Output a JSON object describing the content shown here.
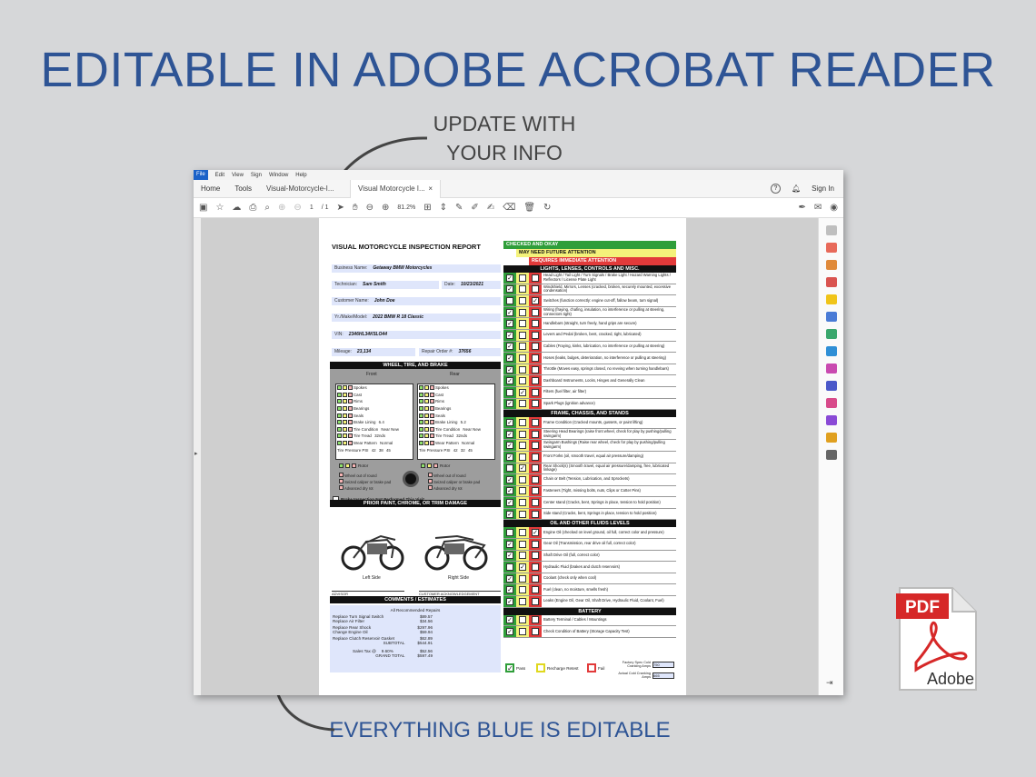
{
  "headline": "EDITABLE IN ADOBE ACROBAT READER",
  "callout_top": [
    "UPDATE WITH",
    "YOUR INFO"
  ],
  "callout_bottom": "EVERYTHING BLUE IS EDITABLE",
  "colors": {
    "headline_blue": "#2e5495",
    "pass_green": "#2f9e3a",
    "attention_yellow": "#f4f27a",
    "fail_red": "#e23a3a",
    "editable_field_blue": "#dfe6fb"
  },
  "app": {
    "menu": [
      "File",
      "Edit",
      "View",
      "Sign",
      "Window",
      "Help"
    ],
    "tabs": {
      "home": "Home",
      "tools": "Tools",
      "doc1": "Visual-Motorcycle-I...",
      "doc2": "Visual Motorcycle I...",
      "close": "×"
    },
    "help": "?",
    "sign_in": "Sign In",
    "page_current": "1",
    "page_total": "/ 1",
    "zoom": "81.2%"
  },
  "form": {
    "title": "VISUAL MOTORCYCLE INSPECTION REPORT",
    "fields": [
      {
        "label": "Business Name:",
        "value": "Getaway BMW Motorcycles"
      },
      {
        "label": "Technician:",
        "value": "Sam Smith"
      },
      {
        "label": "Date:",
        "value": "10/23/2021"
      },
      {
        "label": "Customer Name:",
        "value": "John Doe"
      },
      {
        "label": "Yr./Make/Model:",
        "value": "2022  BMW  R 18  Classic"
      },
      {
        "label": "VIN:",
        "value": "2346HL34K5LO44"
      },
      {
        "label": "Mileage:",
        "value": "23,134"
      },
      {
        "label": "Repair Order #:",
        "value": "37656"
      }
    ],
    "wheel_section": "WHEEL, TIRE, AND BRAKE",
    "front": "Front",
    "rear": "Rear",
    "wheel_items": [
      "Spokes",
      "Cast",
      "Rims",
      "Bearings",
      "Seals",
      "Brake Lining",
      "Tire Condition",
      "Tire Tread",
      "Wear Pattern",
      "Tire Pressure PSI"
    ],
    "front_values": {
      "brake_lining": "6.4",
      "tire_condition": "Near New",
      "tire_tread": "32nds",
      "wear_pattern": "Normal",
      "pressure": "42",
      "before": "38",
      "after": "45"
    },
    "rear_values": {
      "brake_lining": "5.2",
      "tire_condition": "Near New",
      "tire_tread": "32nds",
      "wear_pattern": "Normal",
      "pressure": "42",
      "before": "32",
      "after": "45"
    },
    "rotor": "Rotor",
    "rotor_items": [
      "Wheel out of round",
      "Seized caliper or brake pad",
      "Advanced dry rot"
    ],
    "brake_not_performed": "Brake Inspection Not Performed This Visit",
    "paint_section": "PRIOR PAINT, CHROME, OR TRIM DAMAGE",
    "left_side": "Left Side",
    "right_side": "Right Side",
    "advisor": "ADVISOR",
    "customer_ack": "CUSTOMER ACKNOWLEDGEMENT",
    "comments_section": "COMMENTS / ESTIMATES",
    "comments_header": "All Recommended Repairs",
    "estimates": [
      {
        "item": "Replace Turn Signal Switch",
        "price": "$89.57"
      },
      {
        "item": "Replace Air Filter",
        "price": "$34.56"
      },
      {
        "item": "Replace Rear Shock",
        "price": "$297.96"
      },
      {
        "item": "Change Engine Oil",
        "price": "$59.94"
      },
      {
        "item": "Replace Clutch Reservoir Gasket",
        "price": "$62.89"
      }
    ],
    "subtotal_label": "SUBTOTAL",
    "subtotal": "$544.91",
    "sales_tax_label": "Sales Tax  @",
    "sales_tax_rate": "9.60%",
    "sales_tax": "$52.56",
    "grand_total_label": "GRAND  TOTAL",
    "grand_total": "$597.49",
    "status_headers": [
      "CHECKED AND OKAY",
      "MAY NEED FUTURE ATTENTION",
      "REQUIRES IMMEDIATE ATTENTION"
    ],
    "sections": [
      {
        "title": "LIGHTS, LENSES, CONTROLS AND MISC.",
        "items": [
          {
            "text": "Head Light / Tail Light / Turn Signals / Brake Light / Hazard Warning Lights / Reflectors / License Plate Light",
            "mark": "g"
          },
          {
            "text": "Windshield, Mirrors, Lenses (cracked, broken, securely mounted, excessive condensation)",
            "mark": "g"
          },
          {
            "text": "Switches (function correctly: engine cut-off, fallow beam, turn signal)",
            "mark": "r"
          },
          {
            "text": "Wiring (fraying, chafing, insulation, no interference or pulling at steering, connectors tight)",
            "mark": "g"
          },
          {
            "text": "Handlebars (straight, turn freely, hand grips are secure)",
            "mark": "g"
          },
          {
            "text": "Levers and Pedal (broken, bent, cracked, tight, lubricated)",
            "mark": "g"
          },
          {
            "text": "Cables (Fraying, kinks, lubrication, no interference or pulling at steering)",
            "mark": "g"
          },
          {
            "text": "Hoses (leaks, bulges, deterioration, no interference or pulling at steering)",
            "mark": "g"
          },
          {
            "text": "Throttle (Moves easy, springs closed, no revving when turning handlebars)",
            "mark": "g"
          },
          {
            "text": "Dashboard Instruments, Locks, Hinges and Generally Clean",
            "mark": "g"
          },
          {
            "text": "Filters (fuel filter, air filter)",
            "mark": "y"
          },
          {
            "text": "Spark Plugs (ignition advance)",
            "mark": "g"
          }
        ]
      },
      {
        "title": "FRAME, CHASSIS, AND STANDS",
        "items": [
          {
            "text": "Frame Condition (Cracked mounts, gussets, or paint lifting)",
            "mark": "g"
          },
          {
            "text": "Steering Head Bearings (raise front wheel, check for play by pushing/pulling swingarm)",
            "mark": "g"
          },
          {
            "text": "Swingarm Bushings (Raise rear wheel, check for play by pushing/pulling swingarm)",
            "mark": "g"
          },
          {
            "text": "Front Forks (oil, smooth travel, equal air pressure/damping)",
            "mark": "g"
          },
          {
            "text": "Rear Shock(s) (Smooth travel, equal air pressure/damping, free, lubricated linkage)",
            "mark": "y"
          },
          {
            "text": "Chain or Belt (Tension, Lubrication, and Sprockets)",
            "mark": "g"
          },
          {
            "text": "Fasteners (Tight, missing bolts, nuts, Clips or Cotter Pins)",
            "mark": "g"
          },
          {
            "text": "Center stand (Cracks, bent, Springs in place, tension to hold position)",
            "mark": "g"
          },
          {
            "text": "Side stand (Cracks, bent, Springs in place, tension to hold position)",
            "mark": "g"
          }
        ]
      },
      {
        "title": "OIL AND OTHER FLUIDS LEVELS",
        "items": [
          {
            "text": "Engine Oil (checked on level ground, oil full, correct color and pressure)",
            "mark": "r"
          },
          {
            "text": "Gear Oil (Transmission, rear drive oil full, correct color)",
            "mark": "g"
          },
          {
            "text": "Shaft Drive Oil (full, correct color)",
            "mark": "g"
          },
          {
            "text": "Hydraulic Fluid (brakes and clutch reservoirs)",
            "mark": "y"
          },
          {
            "text": "Coolant (check only when cool)",
            "mark": "g"
          },
          {
            "text": "Fuel (clean, no moisture, smells fresh)",
            "mark": "g"
          },
          {
            "text": "Leaks (Engine Oil, Gear Oil, Shaft Drive, Hydraulic Fluid, Coolant, Fuel)",
            "mark": "g"
          }
        ]
      },
      {
        "title": "BATTERY",
        "items": [
          {
            "text": "Battery Terminal / Cables / Mountings",
            "mark": "g"
          },
          {
            "text": "Check Condition of Battery (Storage Capacity Test)",
            "mark": "g"
          }
        ]
      }
    ],
    "legend": {
      "pass": "Pass",
      "recharge": "Recharge Retest",
      "fail": "Fail",
      "factory_cca": "Factory Spec Cold Cranking Amps",
      "factory_cca_value": "750",
      "actual_cca": "Actual Cold Cranking Amps",
      "actual_cca_value": "665"
    }
  },
  "pdf_icon": {
    "badge": "PDF",
    "brand": "Adobe"
  }
}
